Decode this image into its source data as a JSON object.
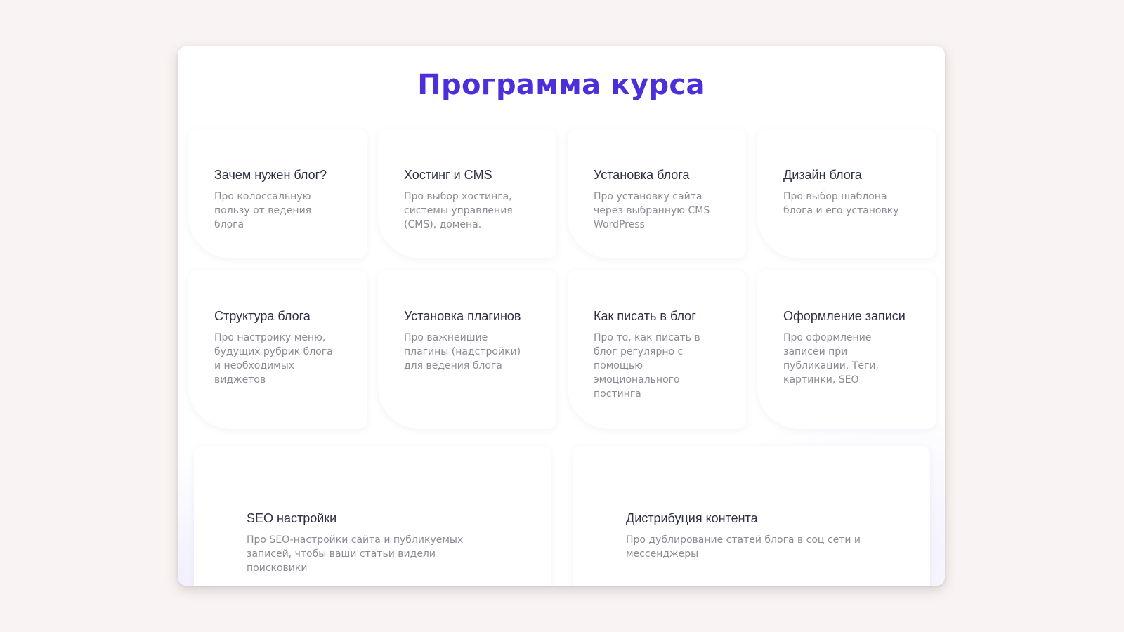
{
  "section": {
    "title": "Программа курса"
  },
  "modules": [
    {
      "title": "Зачем нужен блог?",
      "description": "Про колоссальную пользу от ведения блога"
    },
    {
      "title": "Хостинг и CMS",
      "description": "Про выбор хостинга, системы управления (CMS), домена."
    },
    {
      "title": "Установка блога",
      "description": "Про установку сайта через выбранную CMS WordPress"
    },
    {
      "title": "Дизайн блога",
      "description": "Про выбор шаблона блога и его установку"
    },
    {
      "title": "Структура блога",
      "description": "Про настройку меню, будущих рубрик блога и необходимых виджетов"
    },
    {
      "title": "Установка плагинов",
      "description": "Про важнейшие плагины (надстройки) для ведения блога"
    },
    {
      "title": "Как писать в блог",
      "description": "Про то, как писать в блог регулярно с помощью эмоционального постинга"
    },
    {
      "title": "Оформление записи",
      "description": "Про оформление записей при публикации. Теги, картинки, SEO"
    },
    {
      "title": "SEO настройки",
      "description": "Про SEO-настройки сайта и публикуемых записей, чтобы ваши статьи видели поисковики"
    },
    {
      "title": "Дистрибуция контента",
      "description": "Про дублирование статей блога в соц сети и мессенджеры"
    }
  ],
  "colors": {
    "accent": "#4d2fd9",
    "title_text": "#2e3044",
    "body_text": "#8b8b96",
    "page_background": "#f9f4f3"
  }
}
